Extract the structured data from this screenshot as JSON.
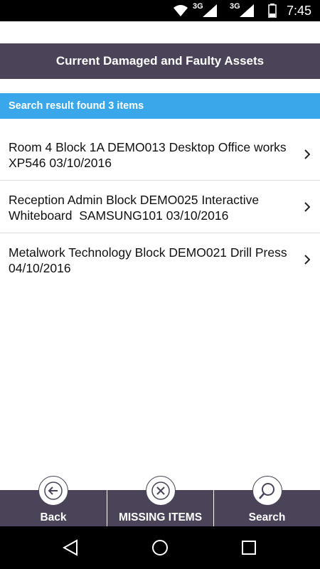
{
  "status_bar": {
    "network_1": "3G",
    "network_2": "3G",
    "time": "7:45",
    "icons": [
      "wifi-icon",
      "signal-icon",
      "signal-icon",
      "battery-icon"
    ]
  },
  "header": {
    "title": "Current Damaged and Faulty Assets"
  },
  "results": {
    "summary": "Search result found 3 items",
    "items": [
      {
        "text": "Room 4 Block 1A DEMO013 Desktop Office works XP546 03/10/2016",
        "icon": "chevron-right-icon"
      },
      {
        "text": "Reception Admin Block DEMO025 Interactive Whiteboard  SAMSUNG101 03/10/2016",
        "icon": "chevron-right-icon"
      },
      {
        "text": "Metalwork Technology Block DEMO021 Drill Press   04/10/2016",
        "icon": "chevron-right-icon"
      }
    ]
  },
  "bottom_nav": {
    "back_label": "Back",
    "missing_label": "MISSING ITEMS",
    "search_label": "Search",
    "icons": [
      "arrow-left-icon",
      "close-icon",
      "search-icon"
    ]
  },
  "system_nav": {
    "icons": [
      "back-triangle-icon",
      "home-circle-icon",
      "recents-square-icon"
    ]
  },
  "colors": {
    "header_bg": "#4b4458",
    "result_bar_bg": "#3aa7ea",
    "text": "#111111"
  }
}
